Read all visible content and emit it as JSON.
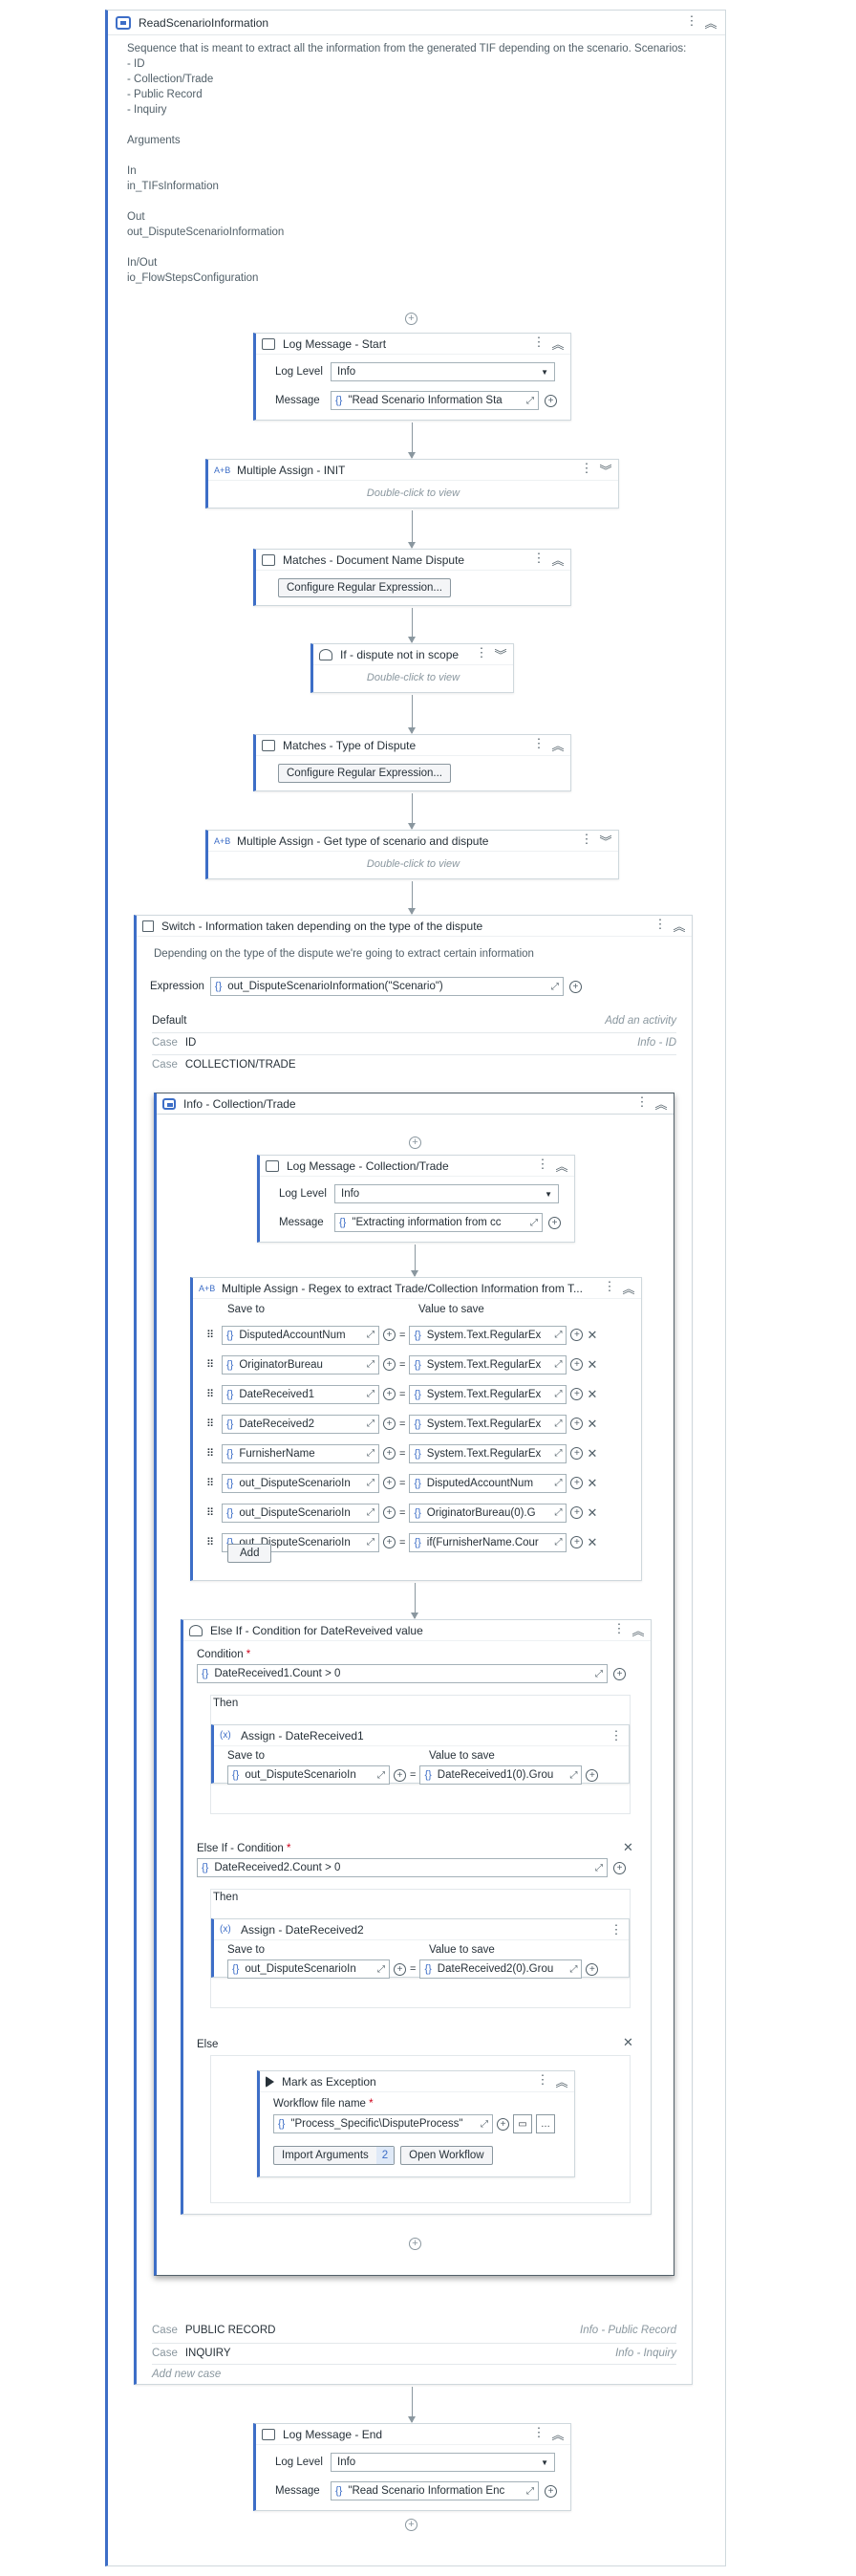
{
  "sequence": {
    "title": "ReadScenarioInformation",
    "annotation": "Sequence that is meant to extract all the information from the generated TIF depending on the scenario. Scenarios:\n- ID\n- Collection/Trade\n- Public Record\n- Inquiry\n\nArguments\n\nIn\nin_TIFsInformation\n\nOut\nout_DisputeScenarioInformation\n\nIn/Out\nio_FlowStepsConfiguration"
  },
  "log_start": {
    "title": "Log Message - Start",
    "level_label": "Log Level",
    "level_value": "Info",
    "message_label": "Message",
    "message_value": "\"Read Scenario Information Sta"
  },
  "assign_init": {
    "title": "Multiple Assign - INIT",
    "hint": "Double-click to view"
  },
  "matches_doc": {
    "title": "Matches - Document Name Dispute",
    "button": "Configure Regular Expression..."
  },
  "if_scope": {
    "title": "If - dispute not in scope",
    "hint": "Double-click to view"
  },
  "matches_type": {
    "title": "Matches - Type of Dispute",
    "button": "Configure Regular Expression..."
  },
  "assign_type": {
    "title": "Multiple Assign - Get type of scenario and dispute",
    "hint": "Double-click to view"
  },
  "switch": {
    "title": "Switch - Information taken depending on the type of the dispute",
    "annotation": "Depending on the type of the dispute we're going to extract certain information",
    "expression_label": "Expression",
    "expression_value": "out_DisputeScenarioInformation(\"Scenario\")",
    "default_label": "Default",
    "add_activity": "Add an activity",
    "case_label": "Case",
    "cases": [
      {
        "name": "ID",
        "target": "Info - ID"
      },
      {
        "name": "COLLECTION/TRADE",
        "target": ""
      },
      {
        "name": "PUBLIC RECORD",
        "target": "Info - Public Record"
      },
      {
        "name": "INQUIRY",
        "target": "Info - Inquiry"
      }
    ],
    "add_case": "Add new case"
  },
  "info_collection": {
    "title": "Info - Collection/Trade"
  },
  "log_collection": {
    "title": "Log Message - Collection/Trade",
    "level_label": "Log Level",
    "level_value": "Info",
    "message_label": "Message",
    "message_value": "\"Extracting information from cc"
  },
  "assign_regex": {
    "title": "Multiple Assign - Regex to extract Trade/Collection Information from T...",
    "save_to_label": "Save to",
    "value_label": "Value to save",
    "add_button": "Add",
    "rows": [
      {
        "to": "DisputedAccountNum",
        "value": "System.Text.RegularEx"
      },
      {
        "to": "OriginatorBureau",
        "value": "System.Text.RegularEx"
      },
      {
        "to": "DateReceived1",
        "value": "System.Text.RegularEx"
      },
      {
        "to": "DateReceived2",
        "value": "System.Text.RegularEx"
      },
      {
        "to": "FurnisherName",
        "value": "System.Text.RegularEx"
      },
      {
        "to": "out_DisputeScenarioIn",
        "value": "DisputedAccountNum"
      },
      {
        "to": "out_DisputeScenarioIn",
        "value": "OriginatorBureau(0).G"
      },
      {
        "to": "out_DisputeScenarioIn",
        "value": "if(FurnisherName.Cour"
      }
    ]
  },
  "elseif": {
    "title": "Else If - Condition for DateReveived value",
    "condition_label": "Condition",
    "condition_value": "DateReceived1.Count > 0",
    "then_label": "Then",
    "assign1": {
      "title": "Assign - DateReceived1",
      "save_to_label": "Save to",
      "value_label": "Value to save",
      "to": "out_DisputeScenarioIn",
      "value": "DateReceived1(0).Grou"
    },
    "elseif_label": "Else If - Condition",
    "condition2_value": "DateReceived2.Count > 0",
    "then2_label": "Then",
    "assign2": {
      "title": "Assign - DateReceived2",
      "save_to_label": "Save to",
      "value_label": "Value to save",
      "to": "out_DisputeScenarioIn",
      "value": "DateReceived2(0).Grou"
    },
    "else_label": "Else",
    "exception": {
      "title": "Mark as Exception",
      "file_label": "Workflow file name",
      "file_value": "\"Process_Specific\\DisputeProcess\"",
      "import_button": "Import Arguments",
      "import_count": "2",
      "open_button": "Open Workflow"
    }
  },
  "log_end": {
    "title": "Log Message - End",
    "level_label": "Log Level",
    "level_value": "Info",
    "message_label": "Message",
    "message_value": "\"Read Scenario Information Enc"
  },
  "icons": [
    "sequence-icon",
    "log-icon",
    "assign-icon",
    "matches-icon",
    "if-icon",
    "switch-icon",
    "exception-icon",
    "more-icon",
    "collapse-icon",
    "expand-icon",
    "add-icon",
    "drag-handle-icon",
    "delete-icon",
    "folder-icon"
  ]
}
